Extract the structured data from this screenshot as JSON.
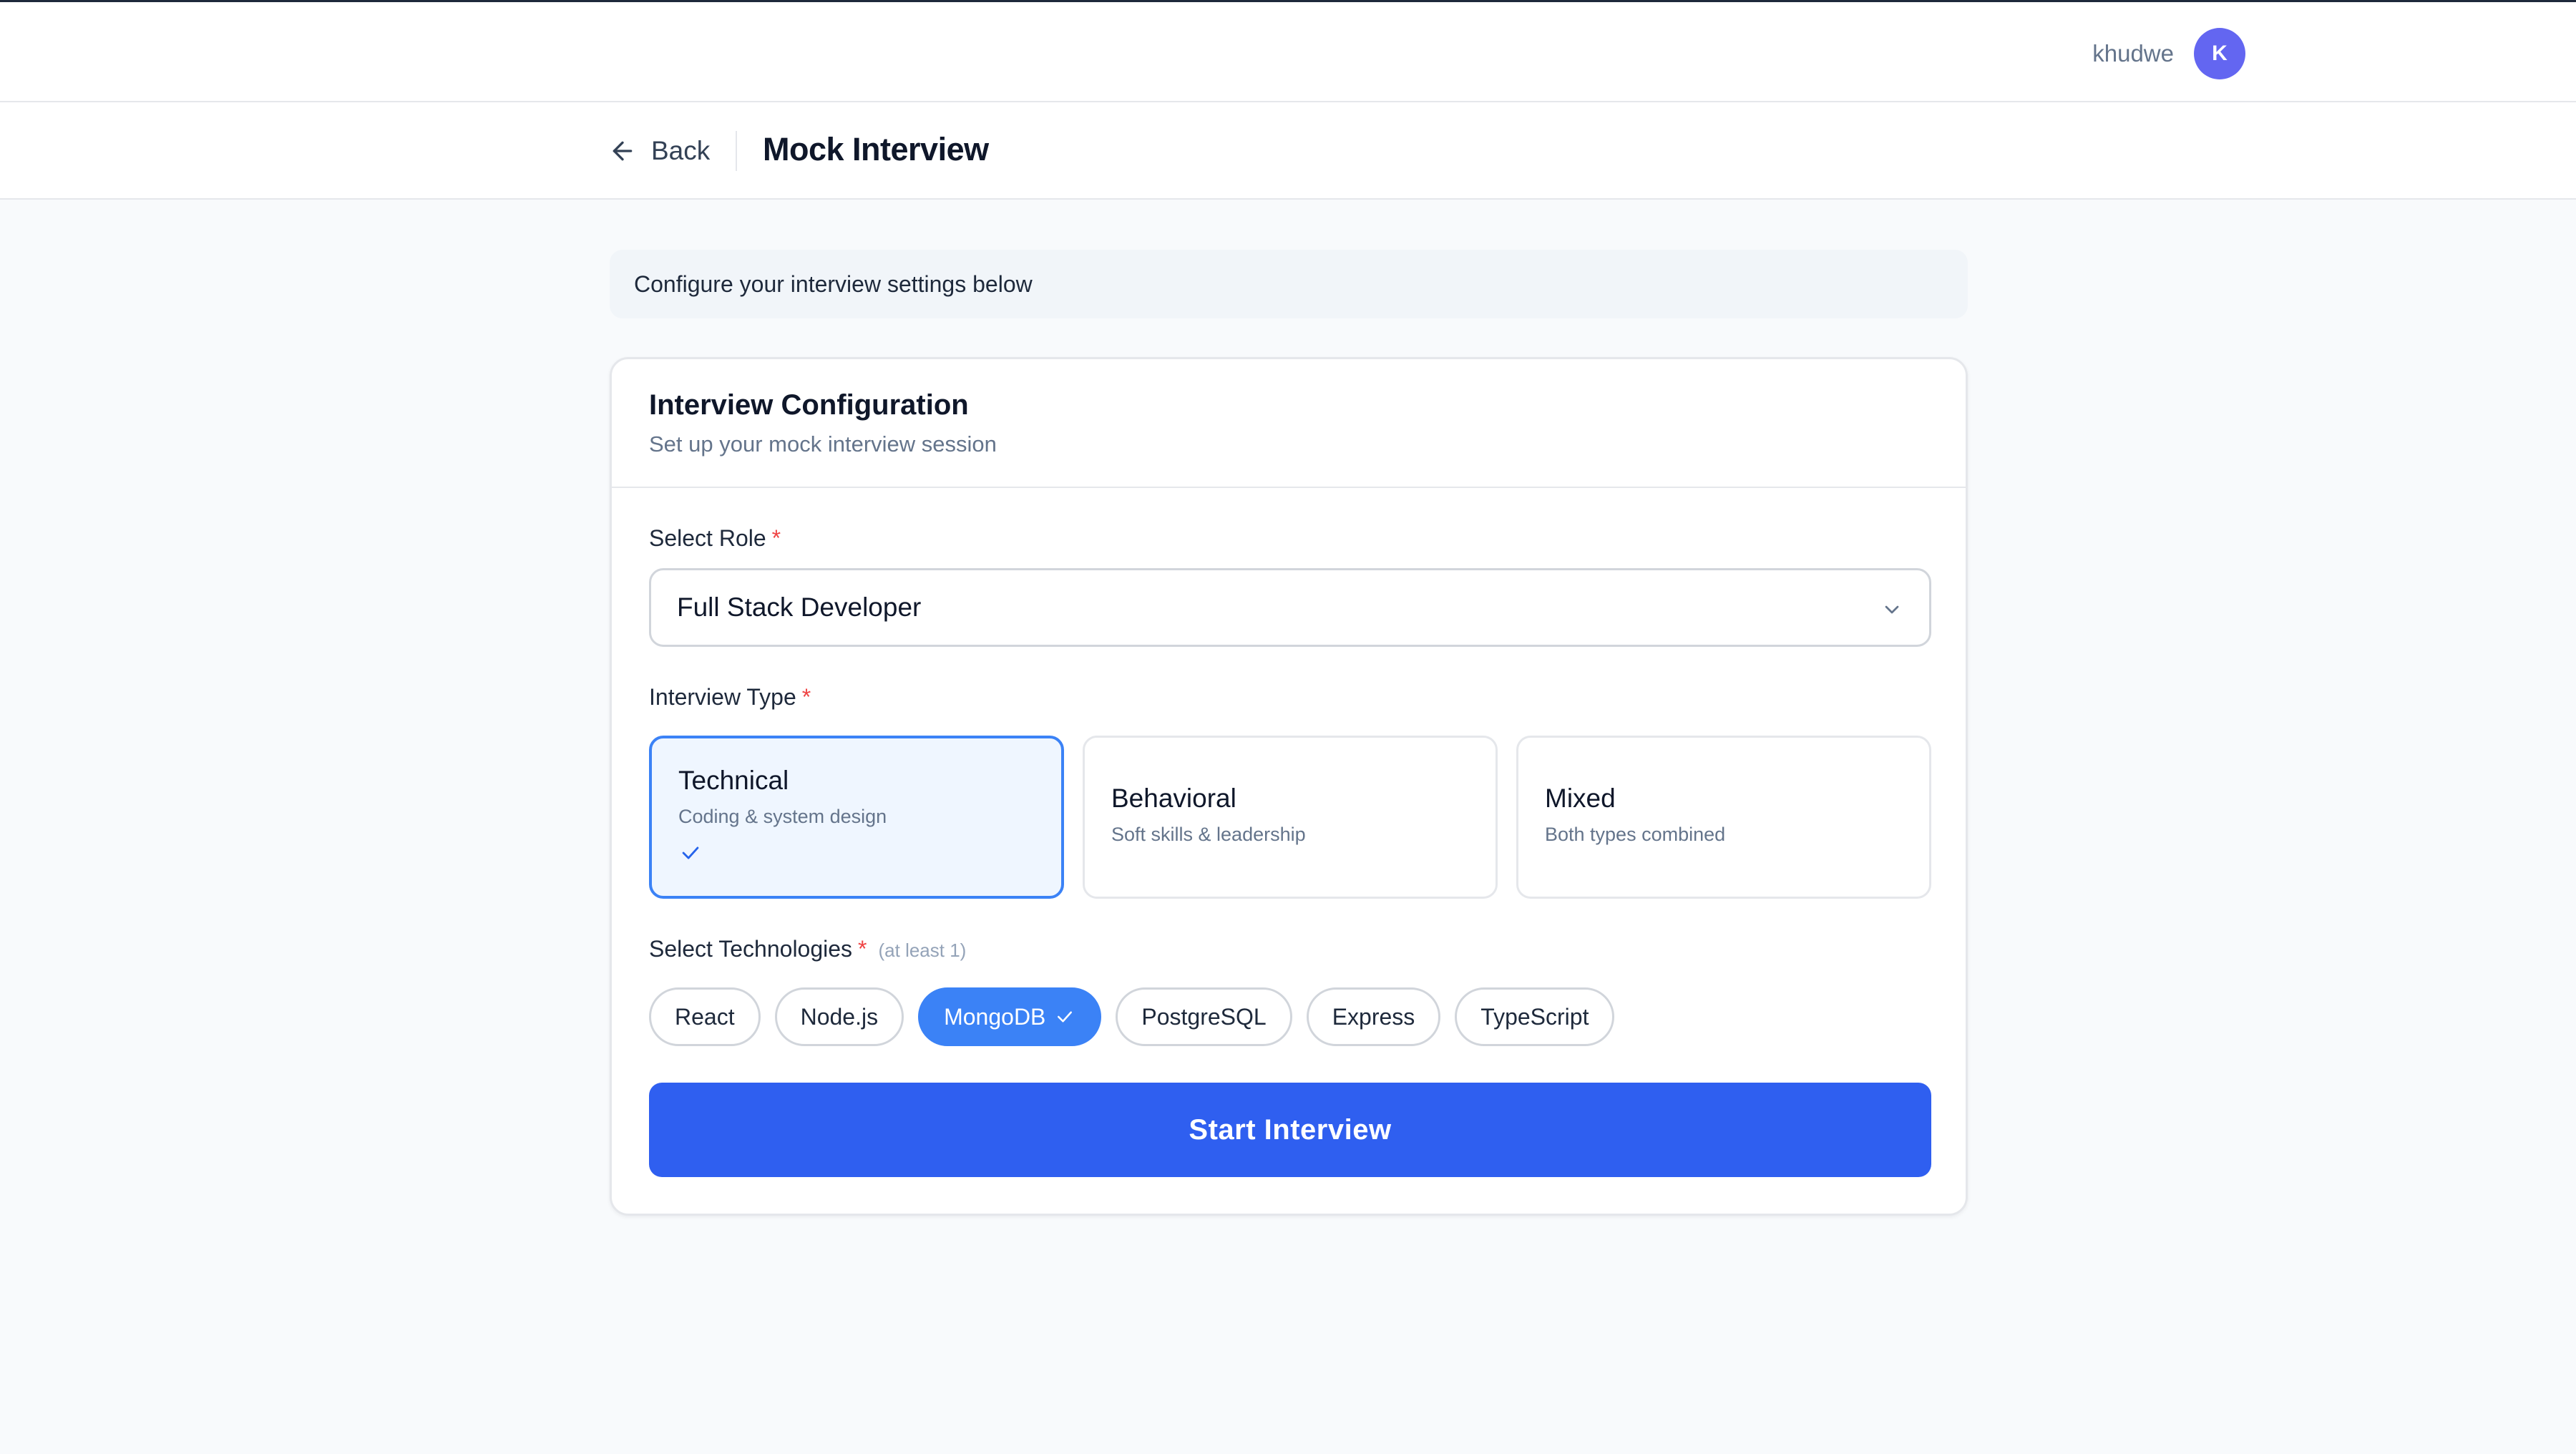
{
  "user": {
    "name": "khudwe",
    "avatar_initial": "K"
  },
  "nav": {
    "back_label": "Back",
    "page_title": "Mock Interview"
  },
  "banner": {
    "text": "Configure your interview settings below"
  },
  "config": {
    "title": "Interview Configuration",
    "subtitle": "Set up your mock interview session",
    "role": {
      "label": "Select Role",
      "required_mark": "*",
      "value": "Full Stack Developer"
    },
    "interview_type": {
      "label": "Interview Type",
      "required_mark": "*",
      "options": [
        {
          "name": "Technical",
          "description": "Coding & system design",
          "selected": true
        },
        {
          "name": "Behavioral",
          "description": "Soft skills & leadership",
          "selected": false
        },
        {
          "name": "Mixed",
          "description": "Both types combined",
          "selected": false
        }
      ]
    },
    "technologies": {
      "label": "Select Technologies",
      "required_mark": "*",
      "hint": "(at least 1)",
      "items": [
        {
          "name": "React",
          "selected": false
        },
        {
          "name": "Node.js",
          "selected": false
        },
        {
          "name": "MongoDB",
          "selected": true
        },
        {
          "name": "PostgreSQL",
          "selected": false
        },
        {
          "name": "Express",
          "selected": false
        },
        {
          "name": "TypeScript",
          "selected": false
        }
      ]
    },
    "start_label": "Start Interview"
  },
  "colors": {
    "primary": "#2f5ff0",
    "selected_chip": "#3b82f6",
    "avatar": "#6366f1",
    "required": "#ef4444"
  },
  "icons": {
    "back": "arrow-left-icon",
    "select": "chevron-down-icon",
    "check": "check-icon"
  }
}
